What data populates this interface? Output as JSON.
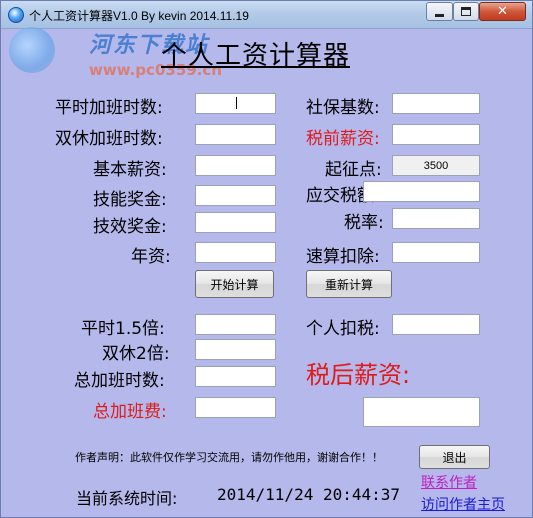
{
  "window": {
    "title": "个人工资计算器V1.0 By kevin 2014.11.19",
    "close_glyph": "✕"
  },
  "watermark": {
    "name": "河东下载站",
    "url": "www.pc0359.cn"
  },
  "app_title": "个人工资计算器",
  "left_fields": [
    {
      "label": "平时加班时数:",
      "value": ""
    },
    {
      "label": "双休加班时数:",
      "value": ""
    },
    {
      "label": "基本薪资:",
      "value": ""
    },
    {
      "label": "技能奖金:",
      "value": ""
    },
    {
      "label": "技效奖金:",
      "value": ""
    },
    {
      "label": "年资:",
      "value": ""
    }
  ],
  "right_fields": [
    {
      "label": "社保基数:",
      "value": ""
    },
    {
      "label": "税前薪资:",
      "value": ""
    },
    {
      "label": "起征点:",
      "value": "3500"
    },
    {
      "label": "应交税额:",
      "value": ""
    },
    {
      "label": "税率:",
      "value": ""
    },
    {
      "label": "速算扣除:",
      "value": ""
    }
  ],
  "buttons": {
    "start": "开始计算",
    "reset": "重新计算",
    "exit": "退出"
  },
  "results_left": [
    {
      "label": "平时1.5倍:",
      "value": ""
    },
    {
      "label": "双休2倍:",
      "value": ""
    },
    {
      "label": "总加班时数:",
      "value": ""
    },
    {
      "label": "总加班费:",
      "value": ""
    }
  ],
  "results_right": {
    "tax_label": "个人扣税:",
    "tax_value": "",
    "net_label": "税后薪资:",
    "net_value": ""
  },
  "disclaimer": "作者声明：此软件仅作学习交流用，请勿作他用，谢谢合作！！",
  "links": {
    "contact": "联系作者",
    "homepage": "访问作者主页"
  },
  "status": {
    "label": "当前系统时间:",
    "time": "2014/11/24 20:44:37"
  },
  "colors": {
    "background": "#b5b8eb",
    "highlight_red": "#e01a1a",
    "link_purple": "#c020c0",
    "link_blue": "#1a1ad8"
  }
}
